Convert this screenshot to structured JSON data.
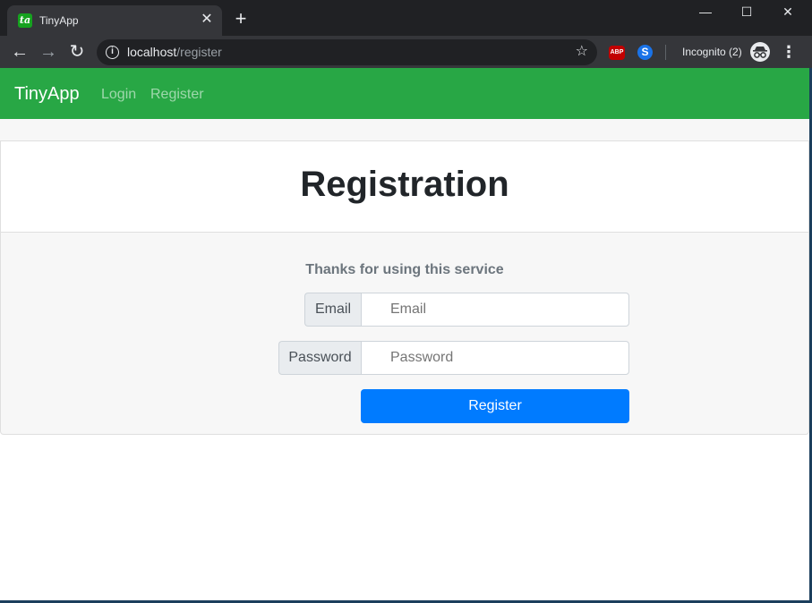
{
  "browser": {
    "tab": {
      "favicon_text": "ta",
      "title": "TinyApp",
      "close_glyph": "✕"
    },
    "new_tab_glyph": "+",
    "window_controls": {
      "minimize": "—",
      "maximize": "☐",
      "close": "✕"
    },
    "toolbar": {
      "back_glyph": "←",
      "forward_glyph": "→",
      "reload_glyph": "↻",
      "url_host": "localhost",
      "url_path": "/register",
      "info_glyph": "i",
      "star_glyph": "☆",
      "ext_abp_label": "ABP",
      "ext_s_label": "S",
      "incognito_label": "Incognito (2)",
      "menu_glyph": "⋮"
    },
    "icons": {
      "back": "back-arrow-icon",
      "forward": "forward-arrow-icon",
      "reload": "reload-icon",
      "info": "info-icon",
      "star": "bookmark-star-icon",
      "incognito": "incognito-icon",
      "menu": "more-vertical-icon"
    },
    "colors": {
      "frame": "#202124",
      "toolbar": "#35363a"
    }
  },
  "navbar": {
    "brand": "TinyApp",
    "links": [
      "Login",
      "Register"
    ],
    "color": "#28a745"
  },
  "page": {
    "title": "Registration",
    "subtitle": "Thanks for using this service",
    "form": {
      "email_label": "Email",
      "email_placeholder": "Email",
      "password_label": "Password",
      "password_placeholder": "Password",
      "submit_label": "Register",
      "submit_color": "#007bff"
    }
  }
}
